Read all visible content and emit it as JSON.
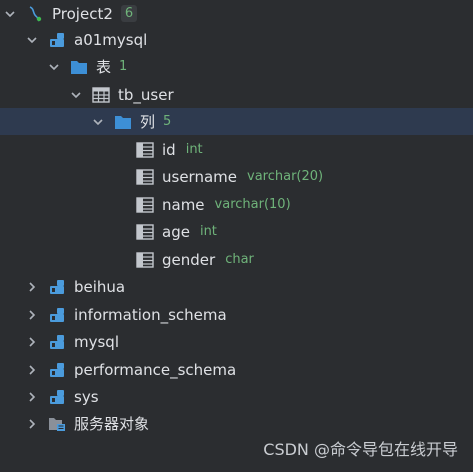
{
  "tree": {
    "project": {
      "label": "Project2",
      "count": "6",
      "icon": "project-datasource-icon"
    },
    "schema_a01": {
      "label": "a01mysql",
      "icon": "schema-icon",
      "tables_folder": {
        "label": "表",
        "count": "1",
        "icon": "folder-icon"
      },
      "table": {
        "label": "tb_user",
        "icon": "table-icon",
        "columns_folder": {
          "label": "列",
          "count": "5",
          "icon": "folder-icon"
        },
        "columns": [
          {
            "name": "id",
            "type": "int"
          },
          {
            "name": "username",
            "type": "varchar(20)"
          },
          {
            "name": "name",
            "type": "varchar(10)"
          },
          {
            "name": "age",
            "type": "int"
          },
          {
            "name": "gender",
            "type": "char"
          }
        ]
      }
    },
    "schemas": [
      {
        "label": "beihua"
      },
      {
        "label": "information_schema"
      },
      {
        "label": "mysql"
      },
      {
        "label": "performance_schema"
      },
      {
        "label": "sys"
      }
    ],
    "server_objects": {
      "label": "服务器对象",
      "icon": "server-objects-icon"
    }
  },
  "watermark": "CSDN @命令导包在线开导",
  "colors": {
    "background": "#2b2d30",
    "selected_row": "#2e3a4f",
    "text": "#dfe1e5",
    "muted_green": "#6fb37a",
    "schema_blue": "#4b9bdc",
    "folder_blue": "#3d8fd6"
  }
}
